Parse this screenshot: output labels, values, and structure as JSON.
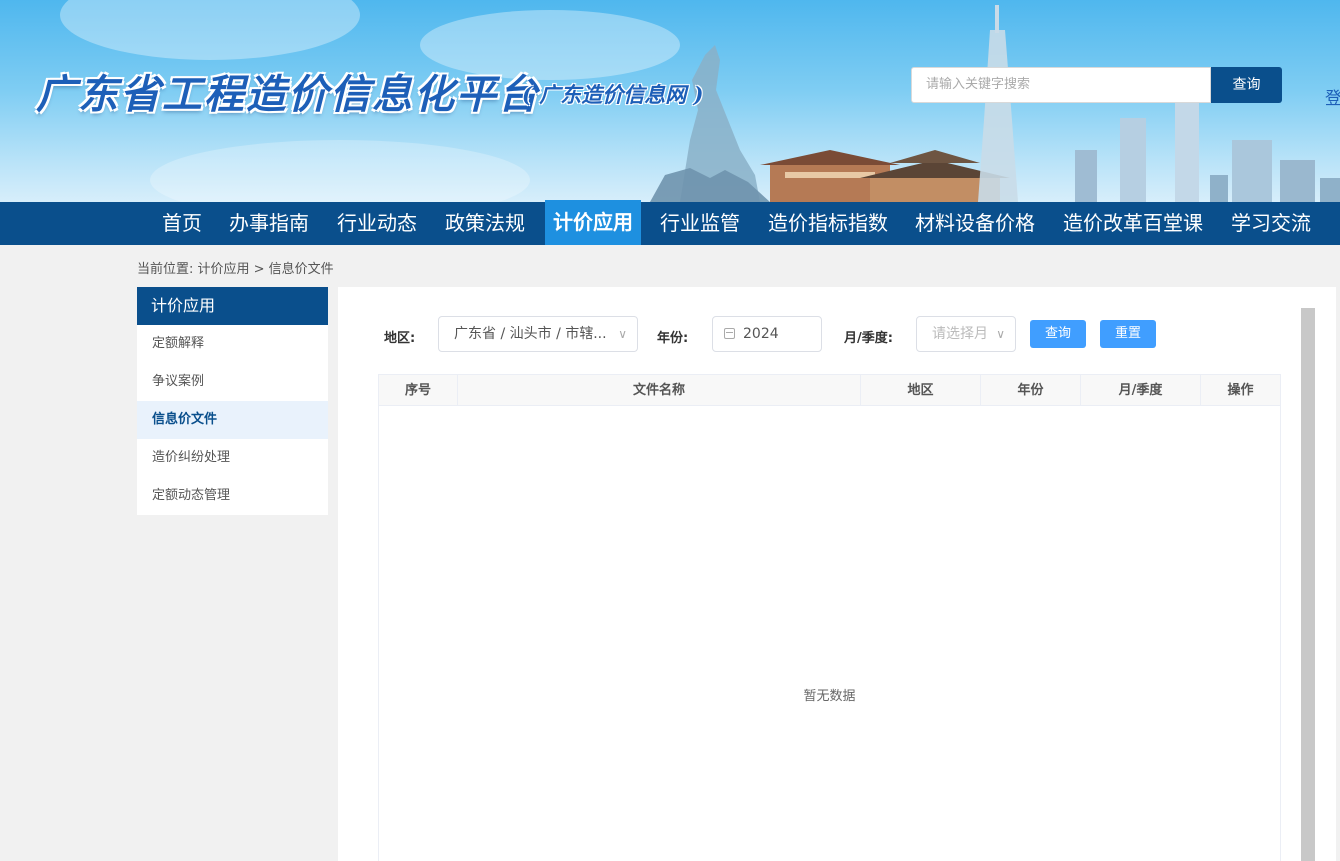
{
  "header": {
    "title": "广东省工程造价信息化平台",
    "subtitle": "( 广东造价信息网 )",
    "search_placeholder": "请输入关键字搜索",
    "search_button": "查询",
    "login": "登"
  },
  "nav": {
    "items": [
      "首页",
      "办事指南",
      "行业动态",
      "政策法规",
      "计价应用",
      "行业监管",
      "造价指标指数",
      "材料设备价格",
      "造价改革百堂课",
      "学习交流"
    ],
    "active_index": 4
  },
  "breadcrumb": "当前位置: 计价应用 > 信息价文件",
  "sidebar": {
    "title": "计价应用",
    "items": [
      "定额解释",
      "争议案例",
      "信息价文件",
      "造价纠纷处理",
      "定额动态管理"
    ],
    "active_index": 2
  },
  "filters": {
    "region_label": "地区:",
    "region_value": "广东省 / 汕头市 / 市辖...",
    "year_label": "年份:",
    "year_value": "2024",
    "month_label": "月/季度:",
    "month_placeholder": "请选择月",
    "query_button": "查询",
    "reset_button": "重置"
  },
  "table": {
    "columns": [
      "序号",
      "文件名称",
      "地区",
      "年份",
      "月/季度",
      "操作"
    ],
    "rows": [],
    "empty_text": "暂无数据"
  },
  "colors": {
    "nav_bg": "#0a4f8c",
    "nav_active": "#1e90e0",
    "button_primary": "#409eff"
  }
}
